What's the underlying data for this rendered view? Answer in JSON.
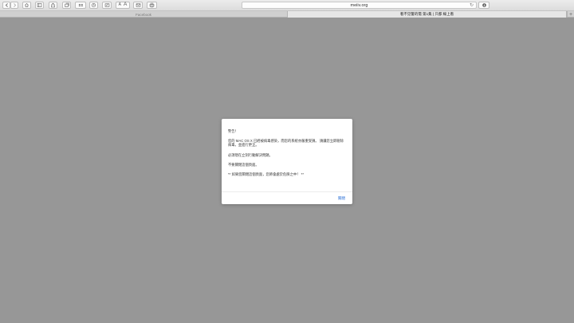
{
  "toolbar": {
    "url": "meiiv.org",
    "text_smaller": "A",
    "text_larger": "A"
  },
  "tabs": [
    {
      "label": "Facebook"
    },
    {
      "label": "看不见警的需 第1集 | 只都 線上看"
    }
  ],
  "dialog": {
    "paragraphs": [
      "警告！",
      "您的 MAC OS X 已經被病毒感染，而您的系統亦嚴重受損。 請讓您立即刪除病毒，並進行更正。",
      "必須現在立刻行動解決問題。",
      "不要關閉這個頁面。",
      "** 如果您關閉這個頁面，您將會處於危險之中！ **"
    ],
    "ok_label": "關閉"
  }
}
